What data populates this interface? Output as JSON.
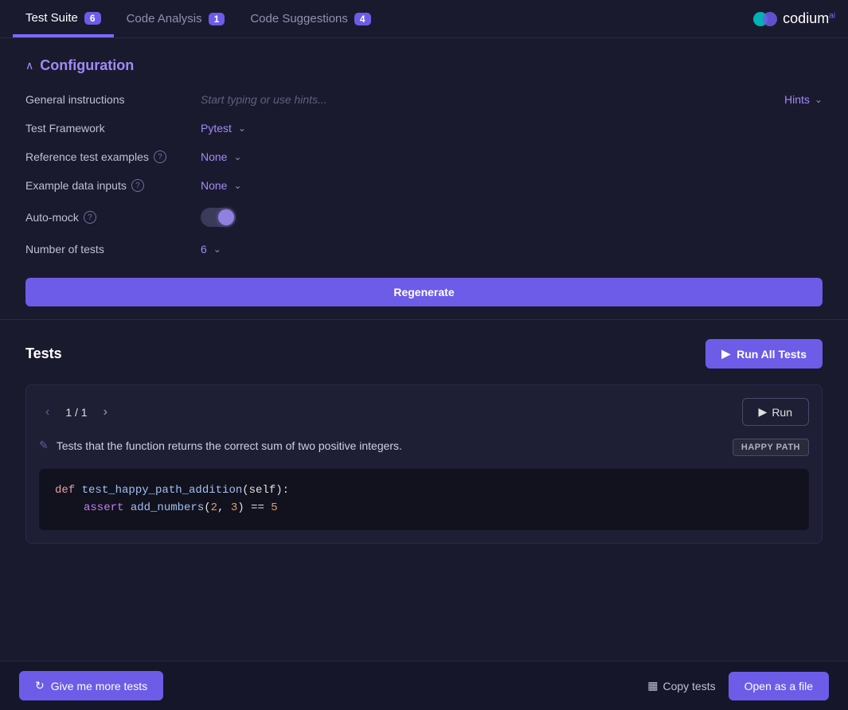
{
  "header": {
    "tabs": [
      {
        "id": "test-suite",
        "label": "Test Suite",
        "badge": "6",
        "active": true
      },
      {
        "id": "code-analysis",
        "label": "Code Analysis",
        "badge": "1",
        "active": false
      },
      {
        "id": "code-suggestions",
        "label": "Code Suggestions",
        "badge": "4",
        "active": false
      }
    ],
    "logo_text": "codium",
    "logo_sup": "ai"
  },
  "configuration": {
    "section_title": "Configuration",
    "chevron": "^",
    "general_instructions_label": "General instructions",
    "general_instructions_placeholder": "Start typing or use hints...",
    "hints_label": "Hints",
    "test_framework_label": "Test Framework",
    "test_framework_value": "Pytest",
    "reference_examples_label": "Reference test examples",
    "reference_examples_help": "?",
    "reference_examples_value": "None",
    "example_data_label": "Example data inputs",
    "example_data_help": "?",
    "example_data_value": "None",
    "auto_mock_label": "Auto-mock",
    "auto_mock_help": "?",
    "num_tests_label": "Number of tests",
    "num_tests_value": "6",
    "regenerate_label": "Regenerate"
  },
  "tests": {
    "section_title": "Tests",
    "run_all_label": "Run All Tests",
    "run_icon": "▶",
    "test_items": [
      {
        "current": "1",
        "total": "1",
        "description": "Tests that the function returns the correct sum of two positive integers.",
        "badge": "HAPPY PATH",
        "run_label": "Run",
        "code_lines": [
          {
            "indent": 0,
            "parts": [
              {
                "type": "keyword",
                "text": "def "
              },
              {
                "type": "func",
                "text": "test_happy_path_addition"
              },
              {
                "type": "params",
                "text": "(self):"
              }
            ]
          },
          {
            "indent": 1,
            "parts": [
              {
                "type": "purple",
                "text": "assert "
              },
              {
                "type": "func",
                "text": "add_numbers"
              },
              {
                "type": "white",
                "text": "("
              },
              {
                "type": "orange",
                "text": "2"
              },
              {
                "type": "white",
                "text": ", "
              },
              {
                "type": "orange",
                "text": "3"
              },
              {
                "type": "white",
                "text": ") == "
              },
              {
                "type": "orange",
                "text": "5"
              }
            ]
          }
        ]
      }
    ]
  },
  "footer": {
    "give_more_label": "Give me more tests",
    "copy_tests_label": "Copy tests",
    "open_as_file_label": "Open as a file"
  }
}
